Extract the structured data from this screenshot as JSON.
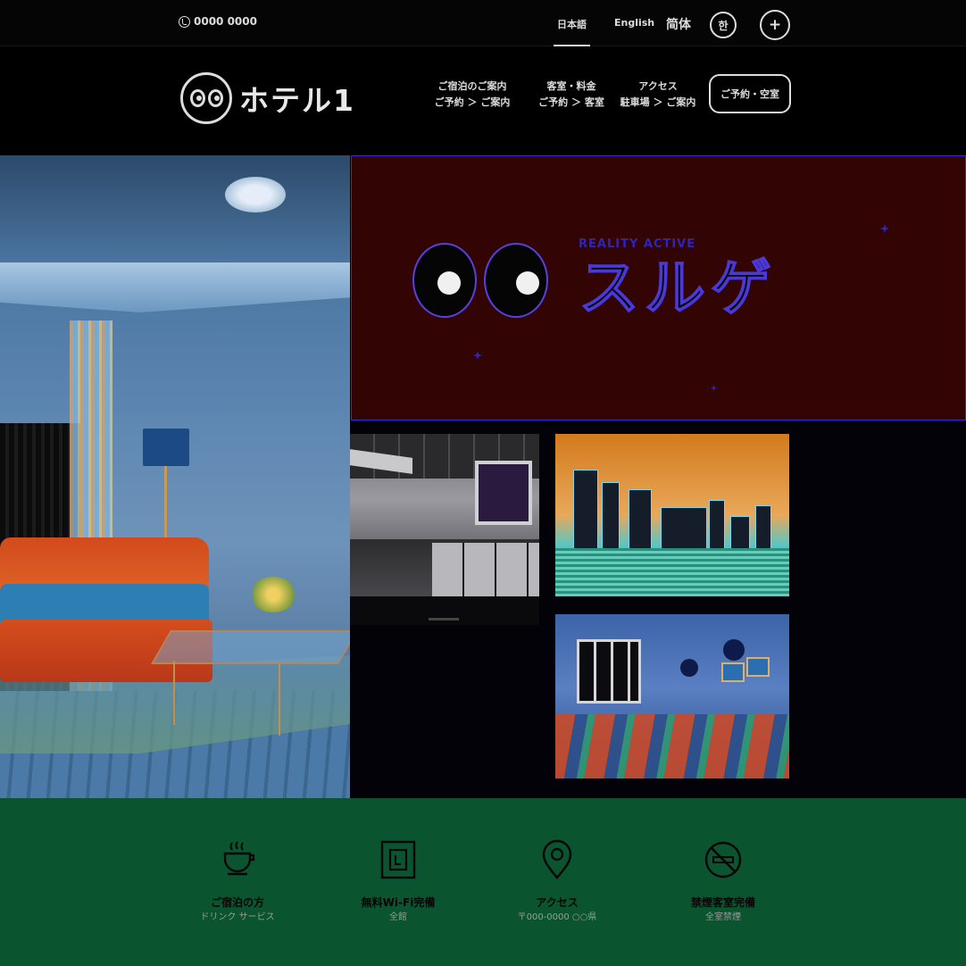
{
  "topbar": {
    "phone": "0000 0000",
    "languages": [
      {
        "label": "日本語",
        "active": true
      },
      {
        "label": "English",
        "active": false
      },
      {
        "label": "简体",
        "active": false
      }
    ],
    "korean_label": "한",
    "plus_label": "+"
  },
  "header": {
    "logo_text": "ホテル1",
    "nav": [
      {
        "line1": "ご宿泊のご案内",
        "line2": "ご予約 ＞ ご案内"
      },
      {
        "line1": "客室・料金",
        "line2": "ご予約 ＞ 客室"
      },
      {
        "line1": "アクセス",
        "line2": "駐車場 ＞ ご案内"
      }
    ],
    "reserve_label": "ご予約・空室"
  },
  "brand": {
    "subtitle": "REALITY ACTIVE",
    "title": "スルゲ"
  },
  "features": [
    {
      "title": "ご宿泊の方",
      "subtitle": "ドリンク サービス",
      "icon": "coffee-icon"
    },
    {
      "title": "無料Wi-Fi完備",
      "subtitle": "全館",
      "icon": "wifi-panel-icon"
    },
    {
      "title": "アクセス",
      "subtitle": "〒000-0000 ○○県",
      "icon": "map-pin-icon"
    },
    {
      "title": "禁煙客室完備",
      "subtitle": "全室禁煙",
      "icon": "no-smoking-icon"
    }
  ],
  "colors": {
    "brand_panel": "#320404",
    "accent": "#3d2bd6",
    "feature_bar": "#0b5430"
  }
}
